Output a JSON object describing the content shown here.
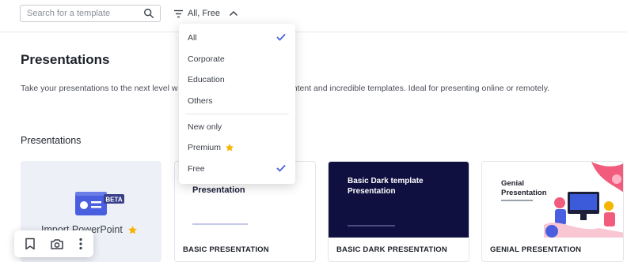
{
  "search": {
    "placeholder": "Search for a template",
    "value": ""
  },
  "filter": {
    "label": "All, Free"
  },
  "page": {
    "title": "Presentations",
    "description": "Take your presentations to the next level w… ements, integrated online content and incredible templates. Ideal for presenting online or remotely.",
    "section_label": "Presentations"
  },
  "dropdown": {
    "categories": [
      {
        "label": "All",
        "checked": true
      },
      {
        "label": "Corporate",
        "checked": false
      },
      {
        "label": "Education",
        "checked": false
      },
      {
        "label": "Others",
        "checked": false
      }
    ],
    "pricing": [
      {
        "label": "New only",
        "checked": false
      },
      {
        "label": "Premium",
        "checked": false,
        "icon": "star-icon"
      },
      {
        "label": "Free",
        "checked": true
      }
    ]
  },
  "cards": {
    "import": {
      "label": "Import PowerPoint",
      "badge": "BETA"
    },
    "basic": {
      "thumb_title": "Presentation",
      "name": "BASIC PRESENTATION"
    },
    "dark": {
      "thumb_title_1": "Basic Dark template",
      "thumb_title_2": "Presentation",
      "name": "BASIC DARK PRESENTATION"
    },
    "genial": {
      "thumb_title_1": "Genial",
      "thumb_title_2": "Presentation",
      "name": "GENIAL PRESENTATION"
    }
  },
  "floating_toolbar": {
    "icons": [
      "bookmark-icon",
      "camera-icon",
      "more-vertical-icon"
    ]
  },
  "colors": {
    "accent": "#4a5fe0",
    "star": "#f4b400",
    "dark_card": "#0f1040",
    "import_bg": "#eef0f8"
  }
}
